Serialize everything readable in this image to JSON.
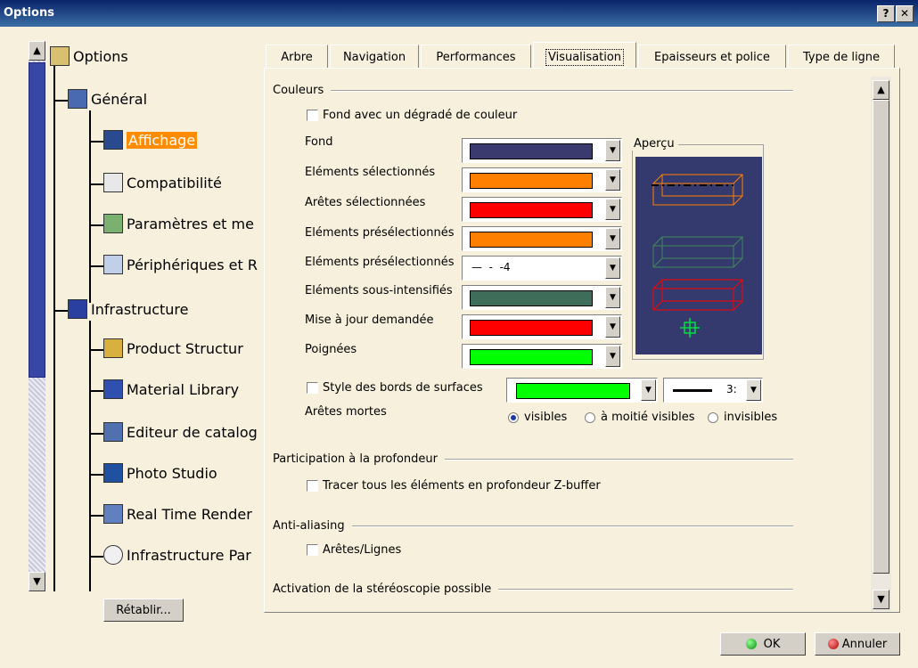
{
  "window": {
    "title": "Options",
    "help_label": "?",
    "close_label": "✕"
  },
  "tree": {
    "root": "Options",
    "items": [
      {
        "label": "Général"
      },
      {
        "label": "Affichage"
      },
      {
        "label": "Compatibilité"
      },
      {
        "label": "Paramètres et me"
      },
      {
        "label": "Périphériques et R"
      },
      {
        "label": "Infrastructure"
      },
      {
        "label": "Product Structur"
      },
      {
        "label": "Material Library"
      },
      {
        "label": "Editeur de catalog"
      },
      {
        "label": "Photo Studio"
      },
      {
        "label": "Real Time Render"
      },
      {
        "label": "Infrastructure Par"
      }
    ],
    "reset_label": "Rétablir..."
  },
  "tabs": [
    "Arbre",
    "Navigation",
    "Performances",
    "Visualisation",
    "Epaisseurs et police",
    "Type de ligne"
  ],
  "colors": {
    "group_label": "Couleurs",
    "gradient_label": "Fond avec un dégradé de couleur",
    "rows": [
      {
        "label": "Fond",
        "color": "#3a3a6e"
      },
      {
        "label": "Eléments sélectionnés",
        "color": "#ff8000"
      },
      {
        "label": "Arêtes sélectionnées",
        "color": "#ff0000"
      },
      {
        "label": "Eléments présélectionnés",
        "color": "#ff8000"
      },
      {
        "label": "Eléments présélectionnés",
        "value": "4"
      },
      {
        "label": "Eléments sous-intensifiés",
        "color": "#3e6e5a"
      },
      {
        "label": "Mise à jour demandée",
        "color": "#ff0000"
      },
      {
        "label": "Poignées",
        "color": "#00ff00"
      }
    ],
    "preview_label": "Aperçu",
    "surface_edge_label": "Style des bords de surfaces",
    "surface_edge_color": "#00ff00",
    "surface_edge_thickness": "3:",
    "dead_edges_label": "Arêtes mortes",
    "dead_edges_options": [
      "visibles",
      "à moitié visibles",
      "invisibles"
    ]
  },
  "depth": {
    "group_label": "Participation à la profondeur",
    "checkbox_label": "Tracer tous les éléments en profondeur Z-buffer"
  },
  "antialias": {
    "group_label": "Anti-aliasing",
    "checkbox_label": "Arêtes/Lignes"
  },
  "stereo": {
    "group_label": "Activation de la stéréoscopie possible"
  },
  "buttons": {
    "ok": "OK",
    "cancel": "Annuler"
  }
}
